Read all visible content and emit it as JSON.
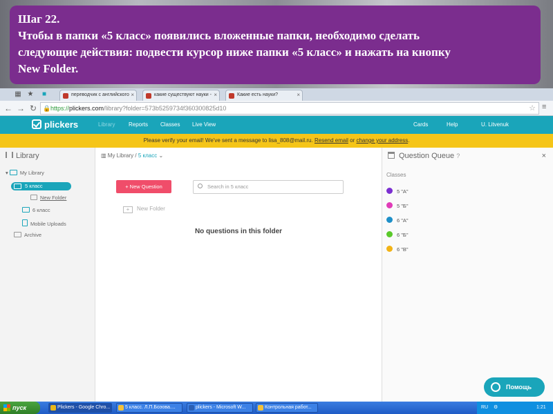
{
  "caption": {
    "line1": "Шаг 22.",
    "line2": "Чтобы в папки «5 класс» появились вложенные папки, необходимо сделать",
    "line3": "следующие действия: подвести курсор ниже папки «5 класс» и нажать на кнопку",
    "line4": "New Folder."
  },
  "tabs": [
    {
      "label": "переводчик с английского",
      "color": "#c0392b"
    },
    {
      "label": "какие существуют науки -",
      "color": "#c0392b"
    },
    {
      "label": "Какие есть науки?",
      "color": "#c0392b"
    }
  ],
  "address": {
    "scheme": "https://",
    "host": "plickers.com",
    "path": "/library?folder=573b5259734f360300825d10"
  },
  "appnav": {
    "logo": "plickers",
    "links": [
      "Library",
      "Reports",
      "Classes",
      "Live View"
    ],
    "right": [
      "Cards",
      "Help",
      "U. Litvenuk"
    ]
  },
  "banner": {
    "text": "Please verify your email! We've sent a message to lisa_808@mail.ru.",
    "resend": "Resend email",
    "or": "or",
    "change": "change your address",
    "period": "."
  },
  "library": {
    "title": "Library",
    "items": {
      "my_library": "My Library",
      "selected": "5 класс",
      "new_folder": "New Folder",
      "class6": "6 класс",
      "mobile": "Mobile Uploads",
      "archive": "Archive"
    }
  },
  "main": {
    "crumb_root": "My Library",
    "crumb_sep": "/",
    "crumb_current": "5 класс",
    "new_question": "+ New Question",
    "search_placeholder": "Search in 5 класс",
    "new_folder": "New Folder",
    "empty": "No questions in this folder"
  },
  "queue": {
    "title": "Question Queue",
    "classes_label": "Classes",
    "classes": [
      {
        "name": "5 \"А\"",
        "color": "#7b2fd1"
      },
      {
        "name": "5 \"Б\"",
        "color": "#e03cb8"
      },
      {
        "name": "6 \"А\"",
        "color": "#1e8fc8"
      },
      {
        "name": "6 \"Б\"",
        "color": "#5ac92a"
      },
      {
        "name": "6 \"В\"",
        "color": "#f2b316"
      }
    ]
  },
  "help_button": "Помощь",
  "taskbar": {
    "start": "пуск",
    "tasks": [
      {
        "label": "Plickers - Google Chro...",
        "color": "#e8b71a"
      },
      {
        "label": "5 класс. Л.П.Боэова....",
        "color": "#f3c13a"
      },
      {
        "label": "plickers - Microsoft W...",
        "color": "#2b5fb4"
      },
      {
        "label": "Контрольная работ...",
        "color": "#f3c13a"
      }
    ],
    "lang": "RU",
    "time": "1:21"
  }
}
